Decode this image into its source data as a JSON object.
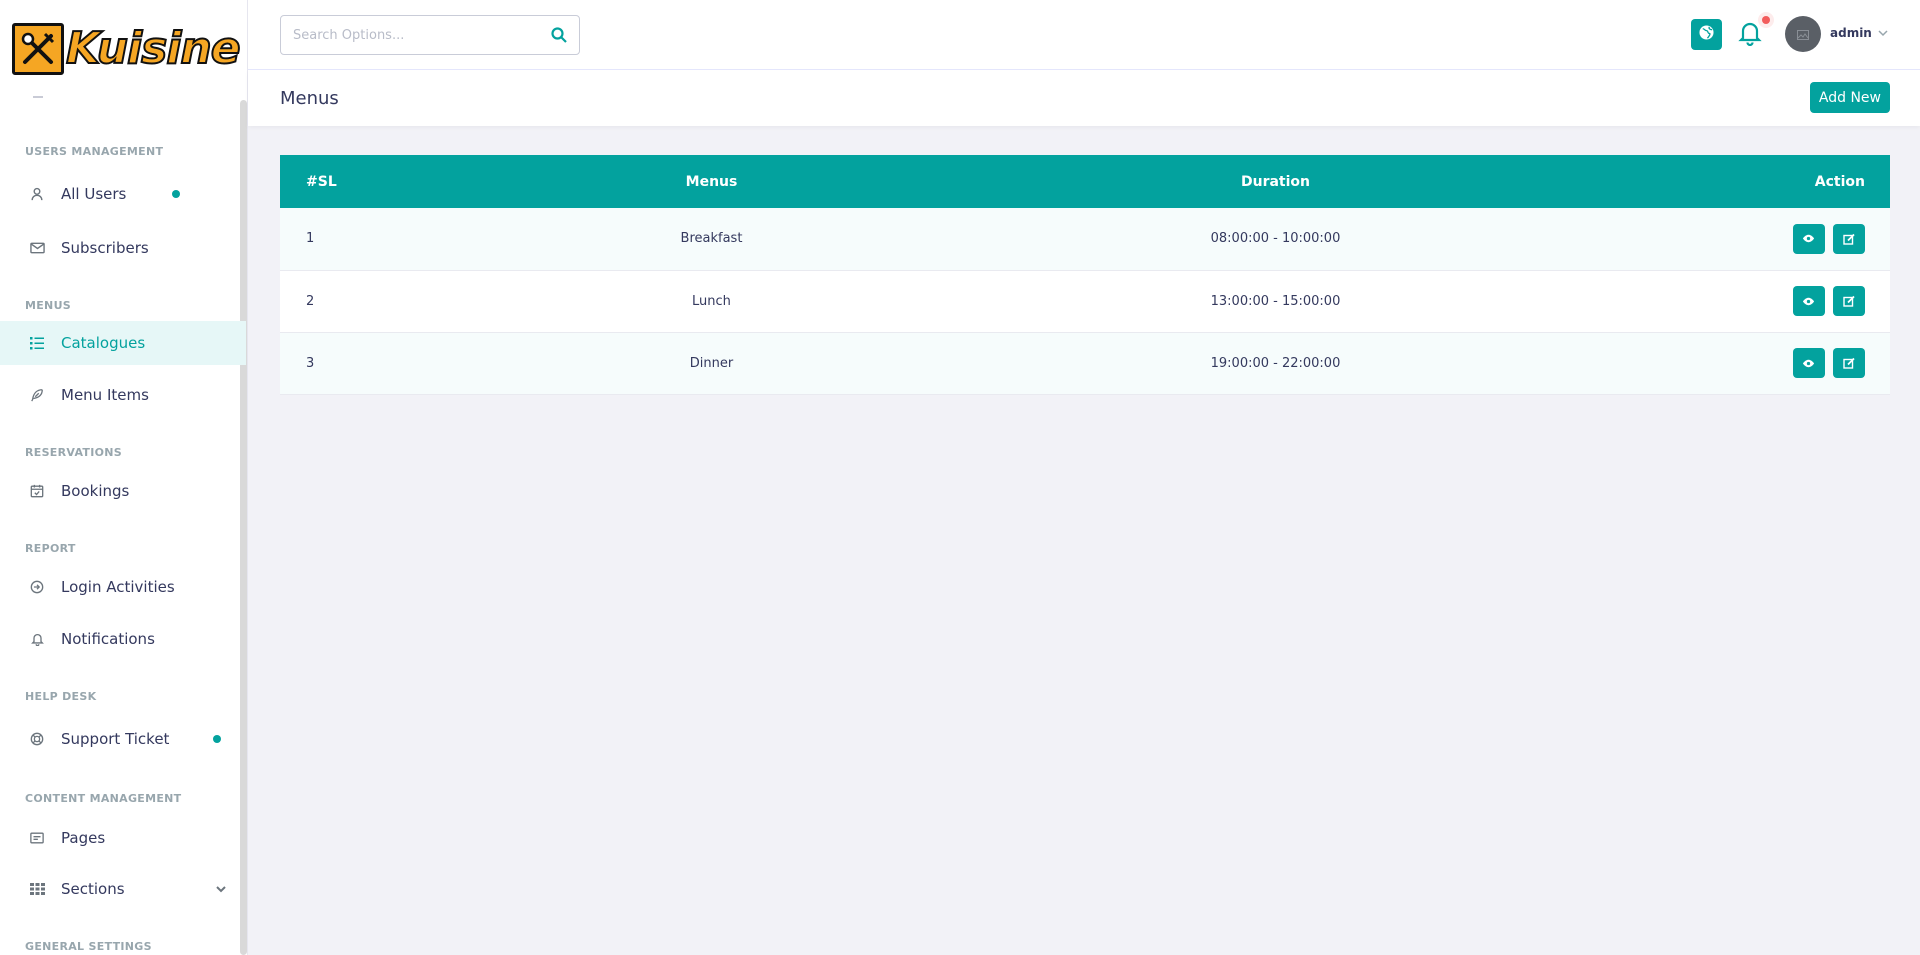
{
  "brand": {
    "name": "Kuisine"
  },
  "search": {
    "placeholder": "Search Options..."
  },
  "user": {
    "name": "admin"
  },
  "sidebar": {
    "sections": [
      {
        "header": "USERS MANAGEMENT"
      },
      {
        "header": "MENUS"
      },
      {
        "header": "RESERVATIONS"
      },
      {
        "header": "REPORT"
      },
      {
        "header": "HELP DESK"
      },
      {
        "header": "CONTENT MANAGEMENT"
      },
      {
        "header": "GENERAL SETTINGS"
      }
    ],
    "items": [
      {
        "label": "All Users",
        "icon": "user-icon"
      },
      {
        "label": "Subscribers",
        "icon": "envelope-icon"
      },
      {
        "label": "Catalogues",
        "icon": "list-icon",
        "active": true
      },
      {
        "label": "Menu Items",
        "icon": "feather-icon"
      },
      {
        "label": "Bookings",
        "icon": "calendar-icon"
      },
      {
        "label": "Login Activities",
        "icon": "sign-in-icon"
      },
      {
        "label": "Notifications",
        "icon": "bell-icon"
      },
      {
        "label": "Support Ticket",
        "icon": "life-ring-icon"
      },
      {
        "label": "Pages",
        "icon": "page-icon"
      },
      {
        "label": "Sections",
        "icon": "grid-icon"
      }
    ]
  },
  "page": {
    "title": "Menus",
    "add_new_label": "Add New"
  },
  "table": {
    "headers": {
      "sl": "#SL",
      "menus": "Menus",
      "duration": "Duration",
      "action": "Action"
    },
    "rows": [
      {
        "sl": "1",
        "menu": "Breakfast",
        "duration": "08:00:00 - 10:00:00"
      },
      {
        "sl": "2",
        "menu": "Lunch",
        "duration": "13:00:00 - 15:00:00"
      },
      {
        "sl": "3",
        "menu": "Dinner",
        "duration": "19:00:00 - 22:00:00"
      }
    ]
  },
  "colors": {
    "accent": "#03a29e",
    "brand": "#f5a623",
    "notification": "#f25c5c"
  }
}
